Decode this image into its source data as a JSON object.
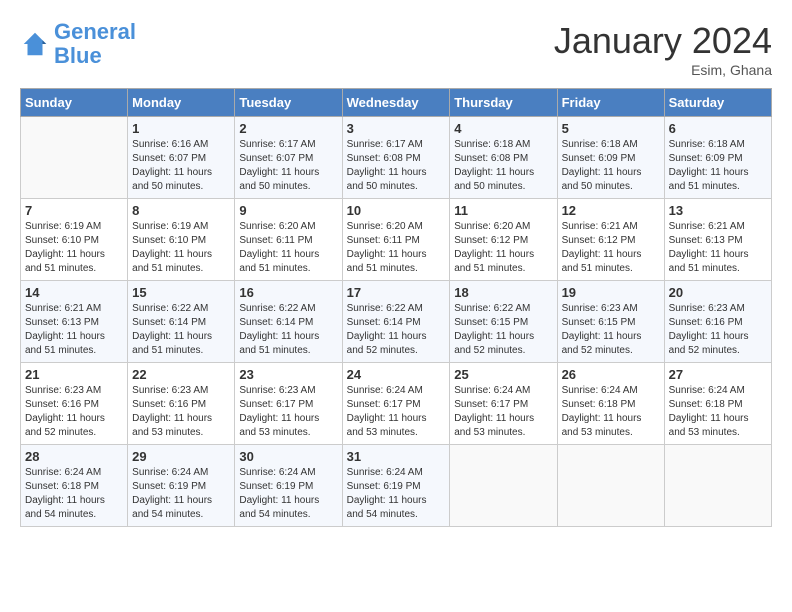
{
  "header": {
    "logo_line1": "General",
    "logo_line2": "Blue",
    "month": "January 2024",
    "location": "Esim, Ghana"
  },
  "days_of_week": [
    "Sunday",
    "Monday",
    "Tuesday",
    "Wednesday",
    "Thursday",
    "Friday",
    "Saturday"
  ],
  "weeks": [
    [
      {
        "num": "",
        "sunrise": "",
        "sunset": "",
        "daylight": ""
      },
      {
        "num": "1",
        "sunrise": "Sunrise: 6:16 AM",
        "sunset": "Sunset: 6:07 PM",
        "daylight": "Daylight: 11 hours and 50 minutes."
      },
      {
        "num": "2",
        "sunrise": "Sunrise: 6:17 AM",
        "sunset": "Sunset: 6:07 PM",
        "daylight": "Daylight: 11 hours and 50 minutes."
      },
      {
        "num": "3",
        "sunrise": "Sunrise: 6:17 AM",
        "sunset": "Sunset: 6:08 PM",
        "daylight": "Daylight: 11 hours and 50 minutes."
      },
      {
        "num": "4",
        "sunrise": "Sunrise: 6:18 AM",
        "sunset": "Sunset: 6:08 PM",
        "daylight": "Daylight: 11 hours and 50 minutes."
      },
      {
        "num": "5",
        "sunrise": "Sunrise: 6:18 AM",
        "sunset": "Sunset: 6:09 PM",
        "daylight": "Daylight: 11 hours and 50 minutes."
      },
      {
        "num": "6",
        "sunrise": "Sunrise: 6:18 AM",
        "sunset": "Sunset: 6:09 PM",
        "daylight": "Daylight: 11 hours and 51 minutes."
      }
    ],
    [
      {
        "num": "7",
        "sunrise": "Sunrise: 6:19 AM",
        "sunset": "Sunset: 6:10 PM",
        "daylight": "Daylight: 11 hours and 51 minutes."
      },
      {
        "num": "8",
        "sunrise": "Sunrise: 6:19 AM",
        "sunset": "Sunset: 6:10 PM",
        "daylight": "Daylight: 11 hours and 51 minutes."
      },
      {
        "num": "9",
        "sunrise": "Sunrise: 6:20 AM",
        "sunset": "Sunset: 6:11 PM",
        "daylight": "Daylight: 11 hours and 51 minutes."
      },
      {
        "num": "10",
        "sunrise": "Sunrise: 6:20 AM",
        "sunset": "Sunset: 6:11 PM",
        "daylight": "Daylight: 11 hours and 51 minutes."
      },
      {
        "num": "11",
        "sunrise": "Sunrise: 6:20 AM",
        "sunset": "Sunset: 6:12 PM",
        "daylight": "Daylight: 11 hours and 51 minutes."
      },
      {
        "num": "12",
        "sunrise": "Sunrise: 6:21 AM",
        "sunset": "Sunset: 6:12 PM",
        "daylight": "Daylight: 11 hours and 51 minutes."
      },
      {
        "num": "13",
        "sunrise": "Sunrise: 6:21 AM",
        "sunset": "Sunset: 6:13 PM",
        "daylight": "Daylight: 11 hours and 51 minutes."
      }
    ],
    [
      {
        "num": "14",
        "sunrise": "Sunrise: 6:21 AM",
        "sunset": "Sunset: 6:13 PM",
        "daylight": "Daylight: 11 hours and 51 minutes."
      },
      {
        "num": "15",
        "sunrise": "Sunrise: 6:22 AM",
        "sunset": "Sunset: 6:14 PM",
        "daylight": "Daylight: 11 hours and 51 minutes."
      },
      {
        "num": "16",
        "sunrise": "Sunrise: 6:22 AM",
        "sunset": "Sunset: 6:14 PM",
        "daylight": "Daylight: 11 hours and 51 minutes."
      },
      {
        "num": "17",
        "sunrise": "Sunrise: 6:22 AM",
        "sunset": "Sunset: 6:14 PM",
        "daylight": "Daylight: 11 hours and 52 minutes."
      },
      {
        "num": "18",
        "sunrise": "Sunrise: 6:22 AM",
        "sunset": "Sunset: 6:15 PM",
        "daylight": "Daylight: 11 hours and 52 minutes."
      },
      {
        "num": "19",
        "sunrise": "Sunrise: 6:23 AM",
        "sunset": "Sunset: 6:15 PM",
        "daylight": "Daylight: 11 hours and 52 minutes."
      },
      {
        "num": "20",
        "sunrise": "Sunrise: 6:23 AM",
        "sunset": "Sunset: 6:16 PM",
        "daylight": "Daylight: 11 hours and 52 minutes."
      }
    ],
    [
      {
        "num": "21",
        "sunrise": "Sunrise: 6:23 AM",
        "sunset": "Sunset: 6:16 PM",
        "daylight": "Daylight: 11 hours and 52 minutes."
      },
      {
        "num": "22",
        "sunrise": "Sunrise: 6:23 AM",
        "sunset": "Sunset: 6:16 PM",
        "daylight": "Daylight: 11 hours and 53 minutes."
      },
      {
        "num": "23",
        "sunrise": "Sunrise: 6:23 AM",
        "sunset": "Sunset: 6:17 PM",
        "daylight": "Daylight: 11 hours and 53 minutes."
      },
      {
        "num": "24",
        "sunrise": "Sunrise: 6:24 AM",
        "sunset": "Sunset: 6:17 PM",
        "daylight": "Daylight: 11 hours and 53 minutes."
      },
      {
        "num": "25",
        "sunrise": "Sunrise: 6:24 AM",
        "sunset": "Sunset: 6:17 PM",
        "daylight": "Daylight: 11 hours and 53 minutes."
      },
      {
        "num": "26",
        "sunrise": "Sunrise: 6:24 AM",
        "sunset": "Sunset: 6:18 PM",
        "daylight": "Daylight: 11 hours and 53 minutes."
      },
      {
        "num": "27",
        "sunrise": "Sunrise: 6:24 AM",
        "sunset": "Sunset: 6:18 PM",
        "daylight": "Daylight: 11 hours and 53 minutes."
      }
    ],
    [
      {
        "num": "28",
        "sunrise": "Sunrise: 6:24 AM",
        "sunset": "Sunset: 6:18 PM",
        "daylight": "Daylight: 11 hours and 54 minutes."
      },
      {
        "num": "29",
        "sunrise": "Sunrise: 6:24 AM",
        "sunset": "Sunset: 6:19 PM",
        "daylight": "Daylight: 11 hours and 54 minutes."
      },
      {
        "num": "30",
        "sunrise": "Sunrise: 6:24 AM",
        "sunset": "Sunset: 6:19 PM",
        "daylight": "Daylight: 11 hours and 54 minutes."
      },
      {
        "num": "31",
        "sunrise": "Sunrise: 6:24 AM",
        "sunset": "Sunset: 6:19 PM",
        "daylight": "Daylight: 11 hours and 54 minutes."
      },
      {
        "num": "",
        "sunrise": "",
        "sunset": "",
        "daylight": ""
      },
      {
        "num": "",
        "sunrise": "",
        "sunset": "",
        "daylight": ""
      },
      {
        "num": "",
        "sunrise": "",
        "sunset": "",
        "daylight": ""
      }
    ]
  ]
}
